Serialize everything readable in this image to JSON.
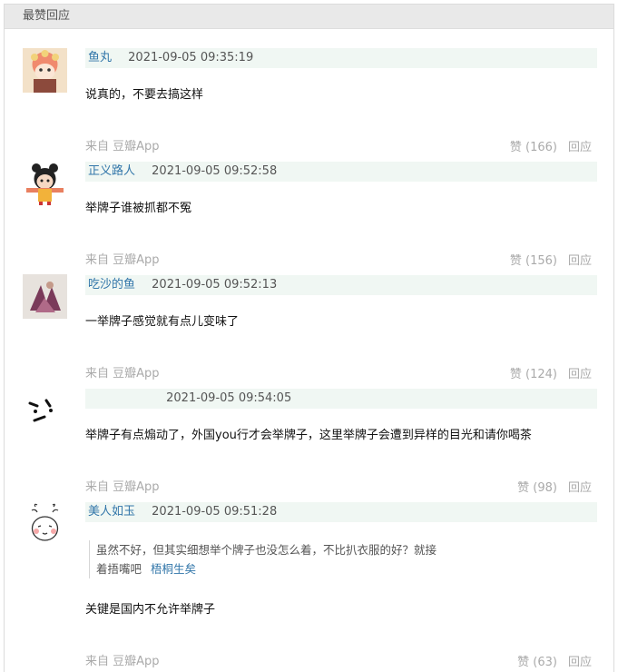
{
  "section": {
    "title": "最赞回应"
  },
  "comments": [
    {
      "author": "鱼丸",
      "time": "2021-09-05 09:35:19",
      "text": "说真的，不要去搞这样",
      "source": "来自 豆瓣App",
      "likes": "赞 (166)",
      "reply": "回应"
    },
    {
      "author": "正义路人",
      "time": "2021-09-05 09:52:58",
      "text": "举牌子谁被抓都不冤",
      "source": "来自 豆瓣App",
      "likes": "赞 (156)",
      "reply": "回应"
    },
    {
      "author": "吃沙的鱼",
      "time": "2021-09-05 09:52:13",
      "text": "一举牌子感觉就有点儿变味了",
      "source": "来自 豆瓣App",
      "likes": "赞 (124)",
      "reply": "回应"
    },
    {
      "author": "",
      "time": "2021-09-05 09:54:05",
      "text": "举牌子有点煽动了，外国you行才会举牌子，这里举牌子会遭到异样的目光和请你喝茶",
      "source": "来自 豆瓣App",
      "likes": "赞 (98)",
      "reply": "回应"
    },
    {
      "author": "美人如玉",
      "time": "2021-09-05 09:51:28",
      "quote_line1": "虽然不好，但其实细想举个牌子也没怎么着，不比扒衣服的好？就接",
      "quote_line2": "着捂嘴吧",
      "quote_author": "梧桐生矣",
      "text": "关键是国内不允许举牌子",
      "source": "来自 豆瓣App",
      "likes": "赞 (63)",
      "reply": "回应"
    }
  ]
}
